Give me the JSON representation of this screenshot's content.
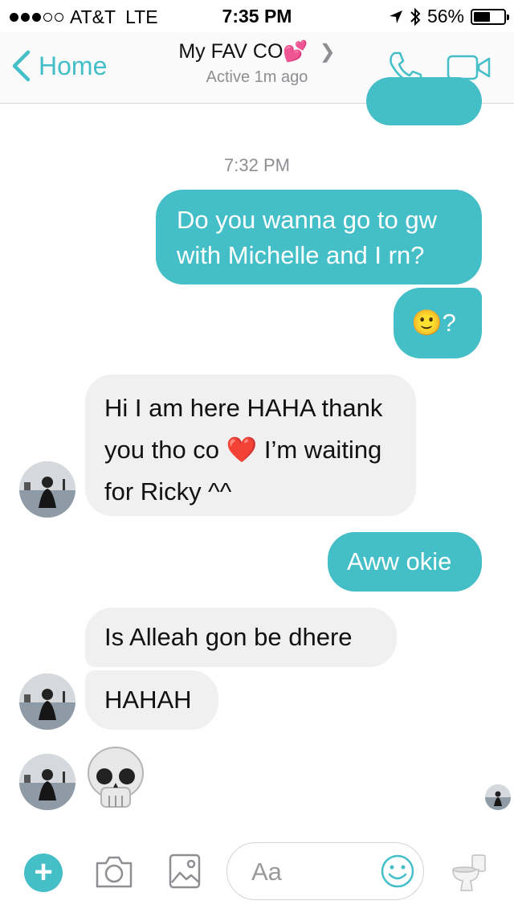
{
  "status_bar": {
    "carrier": "AT&T",
    "network": "LTE",
    "time": "7:35 PM",
    "battery": "56%",
    "battery_level": 0.56
  },
  "header": {
    "back_label": "Home",
    "title": "My FAV CO",
    "title_emoji": "💕",
    "subtitle": "Active 1m ago"
  },
  "thread": {
    "timestamp": "7:32 PM",
    "messages": [
      {
        "from": "me",
        "text": "Do you wanna go to gw with Michelle and I rn?"
      },
      {
        "from": "me",
        "text": "🙂?"
      },
      {
        "from": "them",
        "text": "Hi I am here HAHA thank you tho co ❤️ I’m waiting for Ricky ^^"
      },
      {
        "from": "me",
        "text": "Aww okie"
      },
      {
        "from": "them",
        "text": "Is Alleah gon be dhere"
      },
      {
        "from": "them",
        "text": "HAHAH"
      },
      {
        "from": "them",
        "text": "💀"
      }
    ]
  },
  "composer": {
    "placeholder": "Aa"
  },
  "colors": {
    "accent": "#44bec7",
    "incoming_bubble": "#f1f0f0",
    "subtle_text": "#8e8e93"
  },
  "icons": [
    "back-chevron-icon",
    "phone-icon",
    "video-camera-icon",
    "plus-icon",
    "camera-icon",
    "image-icon",
    "smile-icon",
    "toilet-icon",
    "skull-icon"
  ]
}
